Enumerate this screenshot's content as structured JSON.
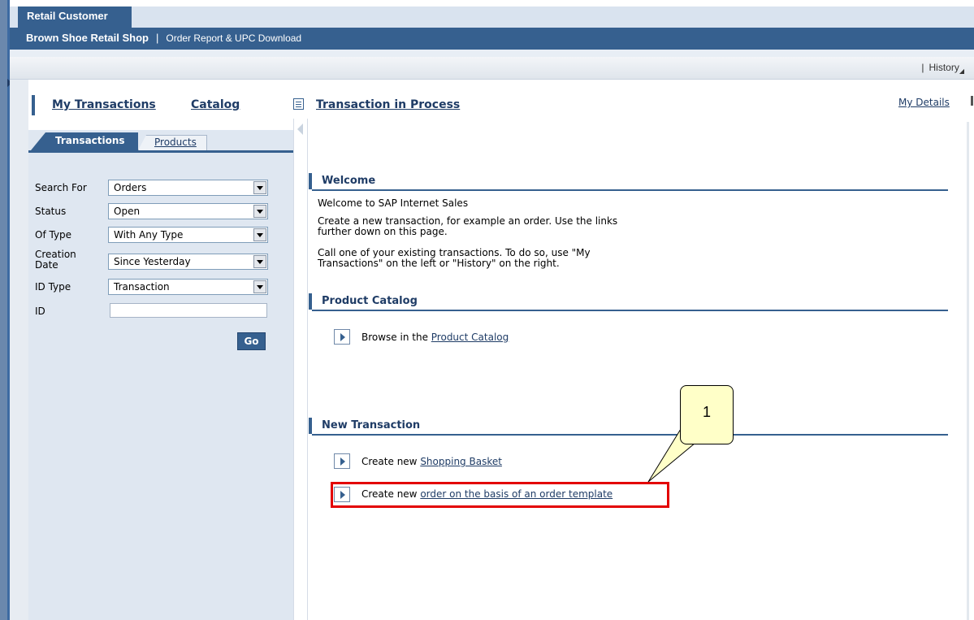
{
  "header": {
    "tab": "Retail Customer",
    "shop": "Brown Shoe Retail Shop",
    "separator": "|",
    "subtitle": "Order Report & UPC Download"
  },
  "history_bar": {
    "separator": "|",
    "history": "History",
    "history_arrow": "◢"
  },
  "nav": {
    "my_transactions": "My Transactions",
    "catalog": "Catalog",
    "transaction_in_process": "Transaction in Process",
    "my_details": "My Details"
  },
  "left_tabs": {
    "transactions": "Transactions",
    "products": "Products"
  },
  "search_form": {
    "search_for_label": "Search For",
    "search_for_value": "Orders",
    "status_label": "Status",
    "status_value": "Open",
    "type_label": "Of Type",
    "type_value": "With Any Type",
    "creation_date_label_1": "Creation",
    "creation_date_label_2": "Date",
    "creation_date_value": "Since Yesterday",
    "id_type_label": "ID Type",
    "id_type_value": "Transaction",
    "id_label": "ID",
    "id_value": "",
    "go": "Go"
  },
  "welcome": {
    "title": "Welcome",
    "line1": "Welcome to SAP Internet Sales",
    "line2a": "Create a new transaction, for example an order. Use the links",
    "line2b": "further down on this page.",
    "line3a": "Call one of your existing transactions. To do so, use \"My",
    "line3b": "Transactions\" on the left or \"History\" on the right."
  },
  "product_catalog": {
    "title": "Product Catalog",
    "browse_prefix": "Browse in the ",
    "browse_link": "Product Catalog"
  },
  "new_transaction": {
    "title": "New Transaction",
    "create_prefix": "Create new ",
    "basket_link": "Shopping Basket",
    "template_link": "order on the basis of an order template"
  },
  "callout": {
    "number": "1"
  },
  "colors": {
    "brand_blue": "#36608f",
    "link_blue": "#1f3c66",
    "highlight_red": "#e30000",
    "callout_fill": "#ffffc8"
  }
}
